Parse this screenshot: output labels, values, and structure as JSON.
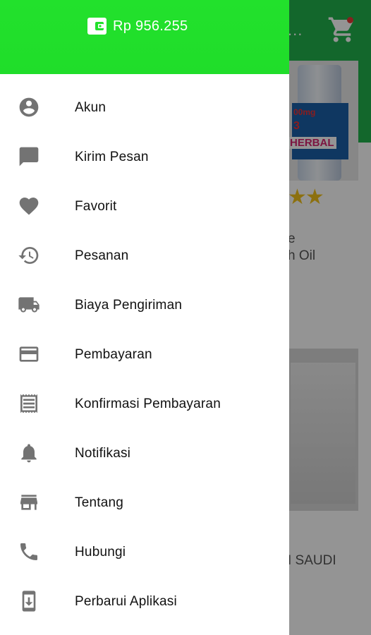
{
  "drawer": {
    "balance": "Rp 956.255",
    "balance_icon": "wallet-icon",
    "header_color": "#22e12c",
    "items": [
      {
        "label": "Akun",
        "icon": "account-circle-icon"
      },
      {
        "label": "Kirim Pesan",
        "icon": "message-icon"
      },
      {
        "label": "Favorit",
        "icon": "heart-icon"
      },
      {
        "label": "Pesanan",
        "icon": "history-icon"
      },
      {
        "label": "Biaya Pengiriman",
        "icon": "truck-icon"
      },
      {
        "label": "Pembayaran",
        "icon": "credit-card-icon"
      },
      {
        "label": "Konfirmasi Pembayaran",
        "icon": "receipt-icon"
      },
      {
        "label": "Notifikasi",
        "icon": "bell-icon"
      },
      {
        "label": "Tentang",
        "icon": "store-icon"
      },
      {
        "label": "Hubungi",
        "icon": "phone-icon"
      },
      {
        "label": "Perbarui Aplikasi",
        "icon": "phone-download-icon"
      }
    ]
  },
  "background": {
    "appbar_color": "#22b14c",
    "more_label": "...",
    "cart_icon": "cart-icon",
    "product1_label_line1": "00mg",
    "product1_label_line2": "3",
    "product1_label_line3": "HERBAL",
    "product1_title_line1": "e",
    "product1_title_line2": "h Oil",
    "product1_stars": "★★",
    "product3_title": "I SAUDI"
  }
}
